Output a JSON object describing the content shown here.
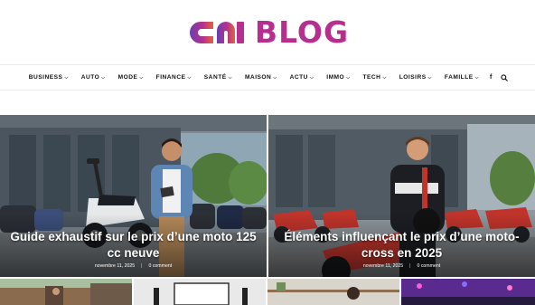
{
  "brand": {
    "name": "BLOG",
    "colors": {
      "magenta": "#b72f8e",
      "purple": "#6b3fb0",
      "orange": "#e0653a"
    }
  },
  "nav": {
    "items": [
      {
        "label": "BUSINESS"
      },
      {
        "label": "AUTO"
      },
      {
        "label": "MODE"
      },
      {
        "label": "FINANCE"
      },
      {
        "label": "SANTÉ"
      },
      {
        "label": "MAISON"
      },
      {
        "label": "ACTU"
      },
      {
        "label": "IMMO"
      },
      {
        "label": "TECH"
      },
      {
        "label": "LOISIRS"
      },
      {
        "label": "FAMILLE"
      }
    ],
    "icons": [
      "facebook-icon",
      "search-icon"
    ]
  },
  "featured": [
    {
      "title": "Guide exhaustif sur le prix d’une moto 125 cc neuve",
      "date": "novembre 11, 2025",
      "comments": "0 comment"
    },
    {
      "title": "Éléments influençant le prix d’une moto-cross en 2025",
      "date": "novembre 11, 2025",
      "comments": "0 comment"
    }
  ]
}
